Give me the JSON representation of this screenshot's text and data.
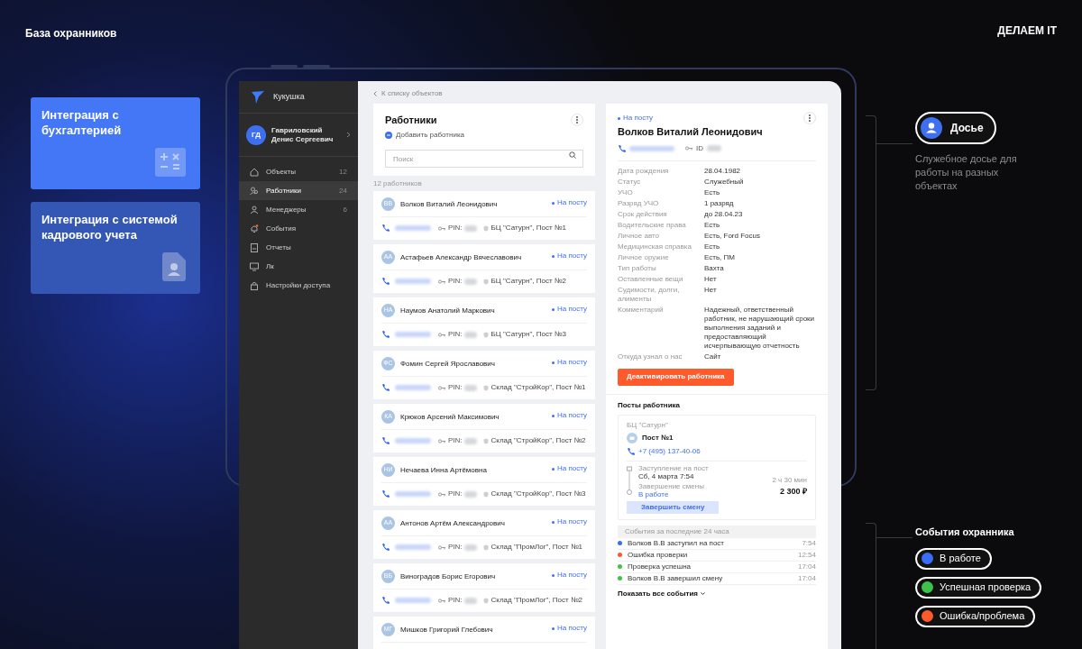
{
  "header": {
    "title": "База охранников",
    "brand": "ДЕЛАЕМ IT"
  },
  "features": [
    {
      "title": "Интеграция с бухгалтерией",
      "kind": "accounting"
    },
    {
      "title": "Интеграция с системой кадрового учета",
      "kind": "hr"
    }
  ],
  "app": {
    "logo": "Кукушка",
    "user": {
      "initials": "ГД",
      "name": "Гавриловский Денис Сергеевич"
    },
    "sidebar": {
      "items": [
        {
          "label": "Объекты",
          "count": "12",
          "selected": false
        },
        {
          "label": "Работники",
          "count": "24",
          "selected": true
        },
        {
          "label": "Менеджеры",
          "count": "6",
          "selected": false
        },
        {
          "label": "События",
          "selected": false
        },
        {
          "label": "Отчеты",
          "selected": false
        },
        {
          "label": "Лк",
          "selected": false
        },
        {
          "label": "Настройки доступа",
          "selected": false
        }
      ]
    },
    "breadcrumb": "К списку объектов",
    "workers": {
      "title": "Работники",
      "add": "Добавить работника",
      "search": {
        "placeholder": "Поиск"
      },
      "count": "12 работников",
      "items": [
        {
          "initials": "ВВ",
          "name": "Волков Виталий Леонидович",
          "status": "На посту",
          "pin": "PIN:",
          "location": "БЦ \"Сатурн\", Пост №1"
        },
        {
          "initials": "АА",
          "name": "Астафьев Александр Вячеславович",
          "status": "На посту",
          "pin": "PIN:",
          "location": "БЦ \"Сатурн\", Пост №2"
        },
        {
          "initials": "НА",
          "name": "Наумов Анатолий Маркович",
          "status": "На посту",
          "pin": "PIN:",
          "location": "БЦ \"Сатурн\", Пост №3"
        },
        {
          "initials": "ФС",
          "name": "Фомин Сергей Ярославович",
          "status": "На посту",
          "pin": "PIN:",
          "location": "Склад \"СтройКор\", Пост №1"
        },
        {
          "initials": "КА",
          "name": "Крюков Арсений Максимович",
          "status": "На посту",
          "pin": "PIN:",
          "location": "Склад \"СтройКор\", Пост №2"
        },
        {
          "initials": "НИ",
          "name": "Нечаева Инна Артёмовна",
          "status": "На посту",
          "pin": "PIN:",
          "location": "Склад \"СтройКор\", Пост №3"
        },
        {
          "initials": "АА",
          "name": "Антонов Артём Александрович",
          "status": "На посту",
          "pin": "PIN:",
          "location": "Склад \"ПромЛог\", Пост №1"
        },
        {
          "initials": "ВБ",
          "name": "Виноградов Борис Егорович",
          "status": "На посту",
          "pin": "PIN:",
          "location": "Склад \"ПромЛог\", Пост №2"
        },
        {
          "initials": "МГ",
          "name": "Мишков Григорий Глебович",
          "status": "На посту"
        }
      ]
    },
    "detail": {
      "status": "На посту",
      "name": "Волков Виталий Леонидович",
      "id_label": "ID",
      "fields": [
        {
          "label": "Дата рождения",
          "value": "28.04.1982"
        },
        {
          "label": "Статус",
          "value": "Служебный"
        },
        {
          "label": "УЧО",
          "value": "Есть"
        },
        {
          "label": "Разряд УЧО",
          "value": "1 разряд"
        },
        {
          "label": "Срок действия",
          "value": "до 28.04.23"
        },
        {
          "label": "Водительские права",
          "value": "Есть"
        },
        {
          "label": "Личное авто",
          "value": "Есть, Ford Focus"
        },
        {
          "label": "Медицинская справка",
          "value": "Есть"
        },
        {
          "label": "Личное оружие",
          "value": "Есть, ПМ"
        },
        {
          "label": "Тип работы",
          "value": "Вахта"
        },
        {
          "label": "Оставленные вещи",
          "value": "Нет"
        },
        {
          "label": "Судимости, долги, алименты",
          "value": "Нет"
        },
        {
          "label": "Комментарий",
          "value": "Надежный, ответственный работник, не нарушающий сроки выполнения заданий и предоставляющий исчерпывающую отчетность"
        },
        {
          "label": "Откуда узнал о нас",
          "value": "Сайт"
        }
      ],
      "deactivate": "Деактивировать работника",
      "posts": {
        "title": "Посты работника",
        "object": "БЦ \"Сатурн\"",
        "post": "Пост №1",
        "phone": "+7 (495) 137-40-06",
        "start_label": "Заступление на пост",
        "start": "Сб, 4 марта 7:54",
        "end_label": "Завершение смены",
        "end": "В работе",
        "duration": "2 ч 30 мин",
        "amount": "2 300 ₽",
        "button": "Завершить смену"
      },
      "events": {
        "title": "События за последние 24 часа",
        "items": [
          {
            "text": "Волков В.В заступил на пост",
            "time": "7:54",
            "color": "#3b6cf6"
          },
          {
            "text": "Ошибка проверки",
            "time": "12:54",
            "color": "#ff5a2b"
          },
          {
            "text": "Проверка успешна",
            "time": "17:04",
            "color": "#3ec24a"
          },
          {
            "text": "Волков В.В завершил смену",
            "time": "17:04",
            "color": "#3ec24a"
          }
        ],
        "more": "Показать все события"
      }
    }
  },
  "dossier": {
    "label": "Досье",
    "caption": "Служебное досье для работы на разных объектах"
  },
  "legend": {
    "title": "События охранника",
    "items": [
      {
        "label": "В работе",
        "color": "#3b6cf6"
      },
      {
        "label": "Успешная проверка",
        "color": "#3ec24a"
      },
      {
        "label": "Ошибка/проблема",
        "color": "#ff5a2b"
      }
    ]
  }
}
